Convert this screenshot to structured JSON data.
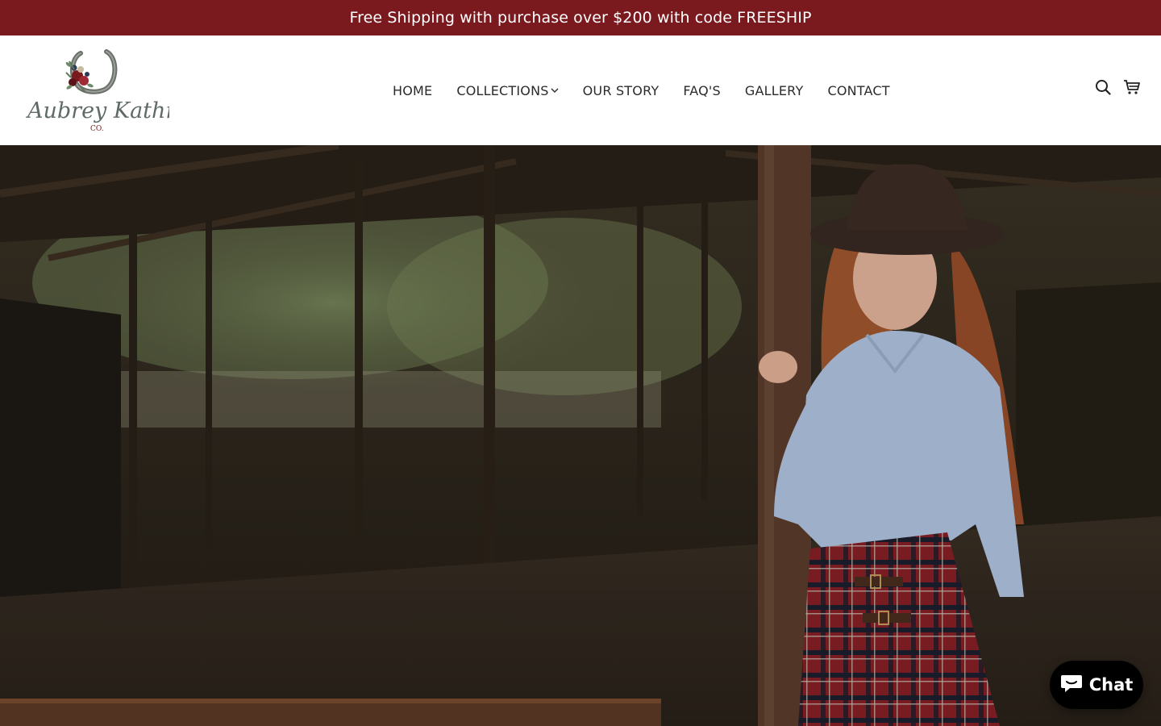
{
  "announcement": {
    "text": "Free Shipping with purchase over $200 with code FREESHIP"
  },
  "brand": {
    "logo_icon": "horseshoe-floral-logo",
    "name": "Aubrey Kathryn",
    "suffix": "CO."
  },
  "nav": {
    "items": [
      {
        "label": "HOME"
      },
      {
        "label": "COLLECTIONS",
        "has_dropdown": true
      },
      {
        "label": "OUR STORY"
      },
      {
        "label": "FAQ'S"
      },
      {
        "label": "GALLERY"
      },
      {
        "label": "CONTACT"
      }
    ]
  },
  "header_icons": {
    "search": "search-icon",
    "cart": "cart-icon"
  },
  "hero": {
    "image": "woman-in-cowboy-hat-barn-photo"
  },
  "chat": {
    "label": "Chat",
    "icon": "chat-bubble-icon"
  },
  "colors": {
    "announcement_bg": "#7b1a1e",
    "nav_text": "#2b2b2b",
    "chat_bg": "#000000"
  }
}
